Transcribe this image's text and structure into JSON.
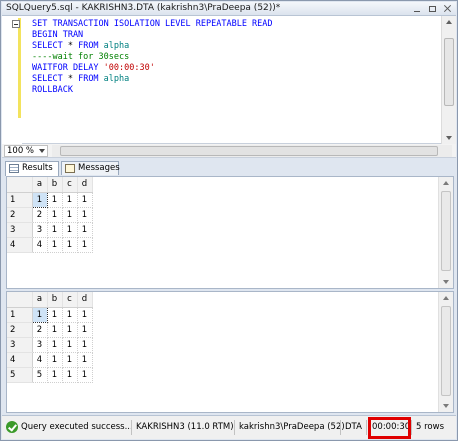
{
  "window": {
    "title": "SQLQuery5.sql - KAKRISHN3.DTA (kakrishn3\\PraDeepa (52))*"
  },
  "editor": {
    "lines": [
      [
        {
          "t": "SET TRANSACTION ISOLATION LEVEL REPEATABLE READ",
          "c": "kw"
        }
      ],
      [
        {
          "t": "BEGIN TRAN",
          "c": "kw"
        }
      ],
      [
        {
          "t": "SELECT",
          "c": "kw"
        },
        {
          "t": " * ",
          "c": ""
        },
        {
          "t": "FROM",
          "c": "kw"
        },
        {
          "t": " alpha",
          "c": "id"
        }
      ],
      [
        {
          "t": "----wait for 30secs",
          "c": "cm"
        }
      ],
      [
        {
          "t": "WAITFOR DELAY ",
          "c": "kw"
        },
        {
          "t": "'00:00:30'",
          "c": "st"
        }
      ],
      [
        {
          "t": "SELECT",
          "c": "kw"
        },
        {
          "t": " * ",
          "c": ""
        },
        {
          "t": "FROM",
          "c": "kw"
        },
        {
          "t": " alpha",
          "c": "id"
        }
      ],
      [
        {
          "t": "ROLLBACK",
          "c": "kw"
        }
      ]
    ]
  },
  "zoom": {
    "value": "100 %"
  },
  "tabs": {
    "results": "Results",
    "messages": "Messages"
  },
  "result_grids": [
    {
      "columns": [
        "a",
        "b",
        "c",
        "d"
      ],
      "rows": [
        [
          "1",
          "1",
          "1",
          "1",
          "1"
        ],
        [
          "2",
          "2",
          "1",
          "1",
          "1"
        ],
        [
          "3",
          "3",
          "1",
          "1",
          "1"
        ],
        [
          "4",
          "4",
          "1",
          "1",
          "1"
        ]
      ]
    },
    {
      "columns": [
        "a",
        "b",
        "c",
        "d"
      ],
      "rows": [
        [
          "1",
          "1",
          "1",
          "1",
          "1"
        ],
        [
          "2",
          "2",
          "1",
          "1",
          "1"
        ],
        [
          "3",
          "3",
          "1",
          "1",
          "1"
        ],
        [
          "4",
          "4",
          "1",
          "1",
          "1"
        ],
        [
          "5",
          "5",
          "1",
          "1",
          "1"
        ]
      ]
    }
  ],
  "status": {
    "message": "Query executed success...",
    "server": "KAKRISHN3 (11.0 RTM)",
    "user": "kakrishn3\\PraDeepa (52)",
    "database": "DTA",
    "elapsed": "00:00:30",
    "rows": "5 rows"
  },
  "colors": {
    "highlight": "#e00000",
    "success": "#3b9a2a",
    "keyword": "#0000ff",
    "identifier": "#008080",
    "comment": "#008000",
    "string": "#c00000"
  }
}
